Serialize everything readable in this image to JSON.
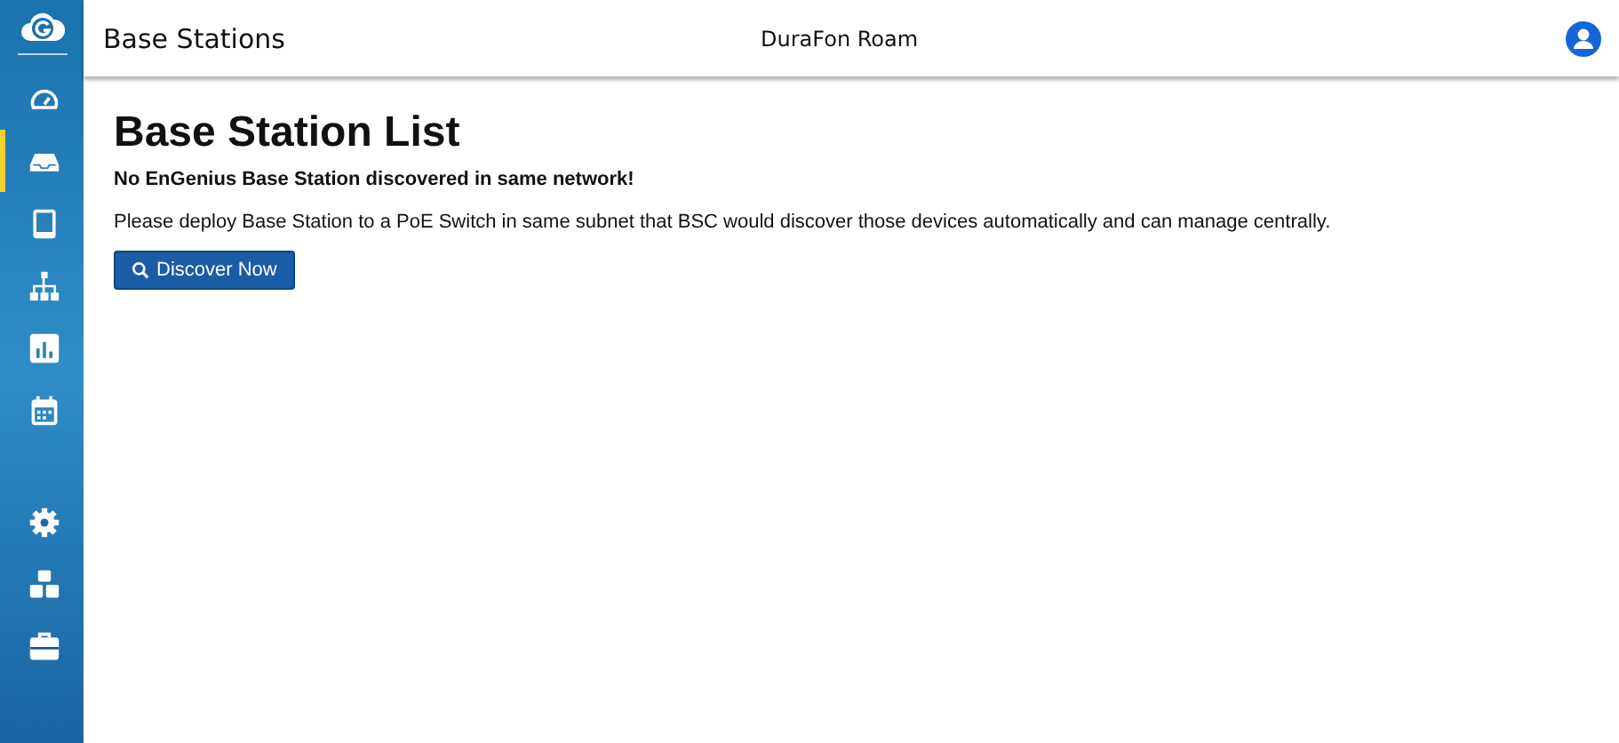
{
  "sidebar": {
    "items": [
      {
        "selected": false
      },
      {
        "selected": true
      },
      {
        "selected": false
      },
      {
        "selected": false
      },
      {
        "selected": false
      },
      {
        "selected": false
      },
      {
        "selected": false
      },
      {
        "selected": false
      },
      {
        "selected": false
      }
    ]
  },
  "header": {
    "title": "Base Stations",
    "product": "DuraFon Roam"
  },
  "page": {
    "heading": "Base Station List",
    "notice": "No EnGenius Base Station discovered in same network!",
    "description": "Please deploy Base Station to a PoE Switch in same subnet that BSC would discover those devices automatically and can manage centrally.",
    "button": "Discover Now"
  }
}
